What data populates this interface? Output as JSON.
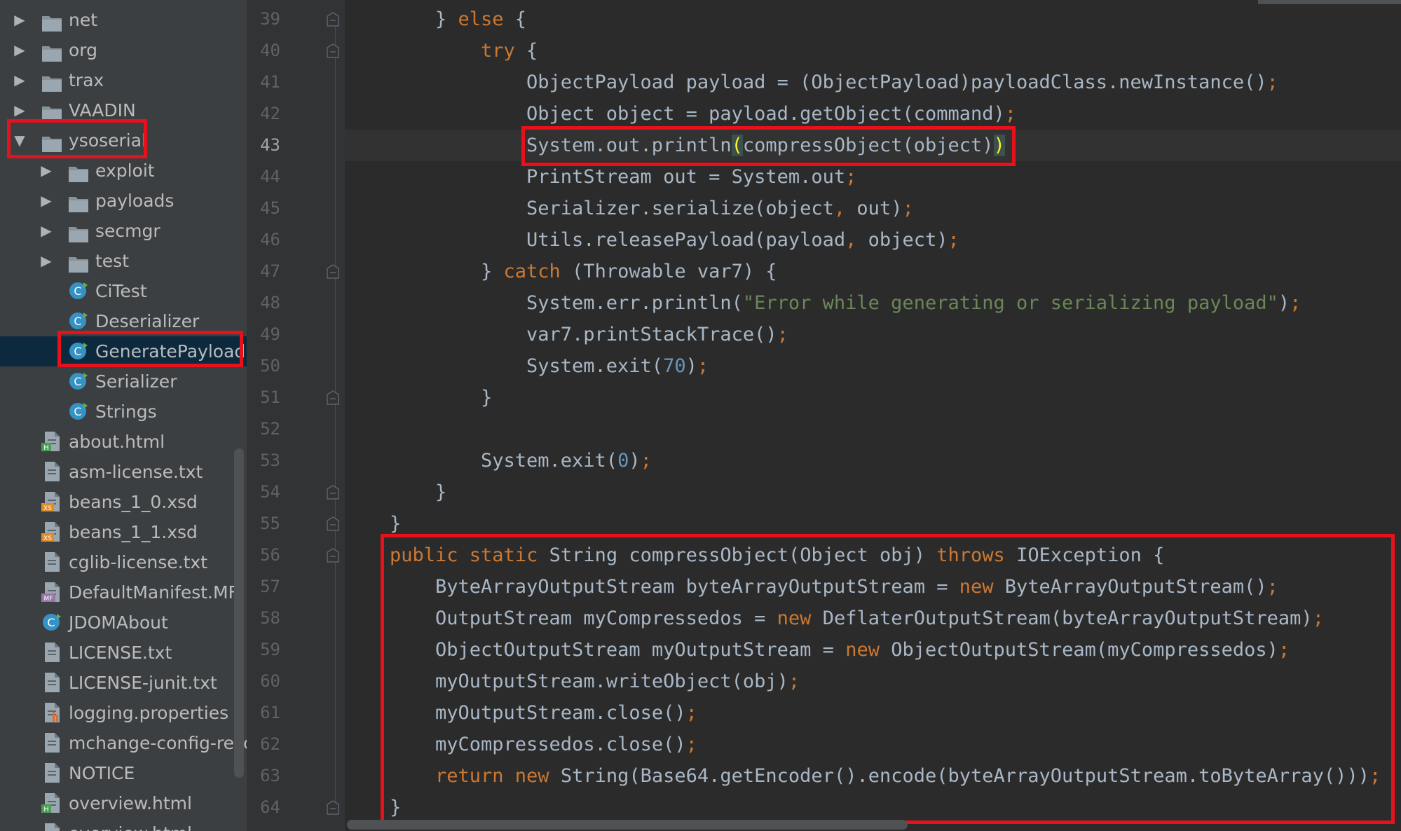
{
  "project_tree": {
    "items": [
      {
        "label": "net",
        "kind": "folder",
        "expanded": false,
        "depth": 0
      },
      {
        "label": "org",
        "kind": "folder",
        "expanded": false,
        "depth": 0
      },
      {
        "label": "trax",
        "kind": "folder",
        "expanded": false,
        "depth": 0
      },
      {
        "label": "VAADIN",
        "kind": "folder",
        "expanded": false,
        "depth": 0
      },
      {
        "label": "ysoserial",
        "kind": "folder",
        "expanded": true,
        "depth": 0,
        "highlighted": true
      },
      {
        "label": "exploit",
        "kind": "folder",
        "expanded": false,
        "depth": 1
      },
      {
        "label": "payloads",
        "kind": "folder",
        "expanded": false,
        "depth": 1
      },
      {
        "label": "secmgr",
        "kind": "folder",
        "expanded": false,
        "depth": 1
      },
      {
        "label": "test",
        "kind": "folder",
        "expanded": false,
        "depth": 1
      },
      {
        "label": "CiTest",
        "kind": "java-class",
        "depth": 1
      },
      {
        "label": "Deserializer",
        "kind": "java-class",
        "depth": 1
      },
      {
        "label": "GeneratePayload",
        "kind": "java-class",
        "depth": 1,
        "selected": true,
        "highlighted": true
      },
      {
        "label": "Serializer",
        "kind": "java-class",
        "depth": 1
      },
      {
        "label": "Strings",
        "kind": "java-class",
        "depth": 1
      },
      {
        "label": "about.html",
        "kind": "html-file",
        "depth": 0
      },
      {
        "label": "asm-license.txt",
        "kind": "text-file",
        "depth": 0
      },
      {
        "label": "beans_1_0.xsd",
        "kind": "xsd-file",
        "depth": 0
      },
      {
        "label": "beans_1_1.xsd",
        "kind": "xsd-file",
        "depth": 0
      },
      {
        "label": "cglib-license.txt",
        "kind": "text-file",
        "depth": 0
      },
      {
        "label": "DefaultManifest.MF",
        "kind": "manifest-file",
        "depth": 0
      },
      {
        "label": "JDOMAbout",
        "kind": "java-class",
        "depth": 0
      },
      {
        "label": "LICENSE.txt",
        "kind": "text-file",
        "depth": 0
      },
      {
        "label": "LICENSE-junit.txt",
        "kind": "text-file",
        "depth": 0
      },
      {
        "label": "logging.properties",
        "kind": "properties-file",
        "depth": 0
      },
      {
        "label": "mchange-config-resou",
        "kind": "text-file",
        "depth": 0
      },
      {
        "label": "NOTICE",
        "kind": "text-file",
        "depth": 0
      },
      {
        "label": "overview.html",
        "kind": "html-file",
        "depth": 0
      },
      {
        "label": "overview.html",
        "kind": "html-file",
        "depth": 0
      }
    ]
  },
  "editor": {
    "current_line": "43",
    "line_numbers": [
      "39",
      "40",
      "41",
      "42",
      "43",
      "44",
      "45",
      "46",
      "47",
      "48",
      "49",
      "50",
      "51",
      "52",
      "53",
      "54",
      "55",
      "56",
      "57",
      "58",
      "59",
      "60",
      "61",
      "62",
      "63",
      "64"
    ],
    "fold_marker_lines": [
      "39",
      "40",
      "47",
      "51",
      "54",
      "55",
      "56",
      "64"
    ],
    "lines": [
      {
        "indent": 4,
        "tokens": [
          [
            "p",
            "} "
          ],
          [
            "k",
            "else"
          ],
          [
            "p",
            " {"
          ]
        ]
      },
      {
        "indent": 5,
        "tokens": [
          [
            "k",
            "try"
          ],
          [
            "p",
            " {"
          ]
        ]
      },
      {
        "indent": 6,
        "tokens": [
          [
            "p",
            "ObjectPayload payload = (ObjectPayload)payloadClass.newInstance()"
          ],
          [
            "k",
            ";"
          ]
        ]
      },
      {
        "indent": 6,
        "tokens": [
          [
            "p",
            "Object object = payload.getObject(command)"
          ],
          [
            "k",
            ";"
          ]
        ]
      },
      {
        "indent": 6,
        "tokens": [
          [
            "p",
            "System.out.println"
          ],
          [
            "b",
            "("
          ],
          [
            "p",
            "compressObject(object)"
          ],
          [
            "b",
            ")"
          ]
        ]
      },
      {
        "indent": 6,
        "tokens": [
          [
            "p",
            "PrintStream out = System.out"
          ],
          [
            "k",
            ";"
          ]
        ]
      },
      {
        "indent": 6,
        "tokens": [
          [
            "p",
            "Serializer.serialize(object"
          ],
          [
            "k",
            ","
          ],
          [
            "p",
            " out)"
          ],
          [
            "k",
            ";"
          ]
        ]
      },
      {
        "indent": 6,
        "tokens": [
          [
            "p",
            "Utils.releasePayload(payload"
          ],
          [
            "k",
            ","
          ],
          [
            "p",
            " object)"
          ],
          [
            "k",
            ";"
          ]
        ]
      },
      {
        "indent": 5,
        "tokens": [
          [
            "p",
            "} "
          ],
          [
            "k",
            "catch"
          ],
          [
            "p",
            " (Throwable var7) {"
          ]
        ]
      },
      {
        "indent": 6,
        "tokens": [
          [
            "p",
            "System.err.println("
          ],
          [
            "s",
            "\"Error while generating or serializing payload\""
          ],
          [
            "p",
            ")"
          ],
          [
            "k",
            ";"
          ]
        ]
      },
      {
        "indent": 6,
        "tokens": [
          [
            "p",
            "var7.printStackTrace()"
          ],
          [
            "k",
            ";"
          ]
        ]
      },
      {
        "indent": 6,
        "tokens": [
          [
            "p",
            "System.exit("
          ],
          [
            "n",
            "70"
          ],
          [
            "p",
            ")"
          ],
          [
            "k",
            ";"
          ]
        ]
      },
      {
        "indent": 5,
        "tokens": [
          [
            "p",
            "}"
          ]
        ]
      },
      {
        "indent": 0,
        "tokens": []
      },
      {
        "indent": 5,
        "tokens": [
          [
            "p",
            "System.exit("
          ],
          [
            "n",
            "0"
          ],
          [
            "p",
            ")"
          ],
          [
            "k",
            ";"
          ]
        ]
      },
      {
        "indent": 4,
        "tokens": [
          [
            "p",
            "}"
          ]
        ]
      },
      {
        "indent": 3,
        "tokens": [
          [
            "p",
            "}"
          ]
        ]
      },
      {
        "indent": 3,
        "tokens": [
          [
            "k",
            "public static"
          ],
          [
            "p",
            " String compressObject(Object obj) "
          ],
          [
            "k",
            "throws"
          ],
          [
            "p",
            " IOException {"
          ]
        ]
      },
      {
        "indent": 4,
        "tokens": [
          [
            "p",
            "ByteArrayOutputStream byteArrayOutputStream = "
          ],
          [
            "k",
            "new"
          ],
          [
            "p",
            " ByteArrayOutputStream()"
          ],
          [
            "k",
            ";"
          ]
        ]
      },
      {
        "indent": 4,
        "tokens": [
          [
            "p",
            "OutputStream myCompressedos = "
          ],
          [
            "k",
            "new"
          ],
          [
            "p",
            " DeflaterOutputStream(byteArrayOutputStream)"
          ],
          [
            "k",
            ";"
          ]
        ]
      },
      {
        "indent": 4,
        "tokens": [
          [
            "p",
            "ObjectOutputStream myOutputStream = "
          ],
          [
            "k",
            "new"
          ],
          [
            "p",
            " ObjectOutputStream(myCompressedos)"
          ],
          [
            "k",
            ";"
          ]
        ]
      },
      {
        "indent": 4,
        "tokens": [
          [
            "p",
            "myOutputStream.writeObject(obj)"
          ],
          [
            "k",
            ";"
          ]
        ]
      },
      {
        "indent": 4,
        "tokens": [
          [
            "p",
            "myOutputStream.close()"
          ],
          [
            "k",
            ";"
          ]
        ]
      },
      {
        "indent": 4,
        "tokens": [
          [
            "p",
            "myCompressedos.close()"
          ],
          [
            "k",
            ";"
          ]
        ]
      },
      {
        "indent": 4,
        "tokens": [
          [
            "k",
            "return new"
          ],
          [
            "p",
            " String(Base64.getEncoder().encode(byteArrayOutputStream.toByteArray()))"
          ],
          [
            "k",
            ";"
          ]
        ]
      },
      {
        "indent": 3,
        "tokens": [
          [
            "p",
            "}"
          ]
        ]
      }
    ]
  },
  "annotations": {
    "highlight_color": "#e8111b",
    "boxes": [
      "ysoserial-folder",
      "GeneratePayload-file",
      "println-compressObject-call",
      "compressObject-method"
    ]
  },
  "colors": {
    "editor_bg": "#2b2b2b",
    "tree_bg": "#3c3f41",
    "keyword": "#cc7832",
    "string": "#6a8759",
    "number": "#6897bb",
    "default_text": "#a9b7c6"
  }
}
